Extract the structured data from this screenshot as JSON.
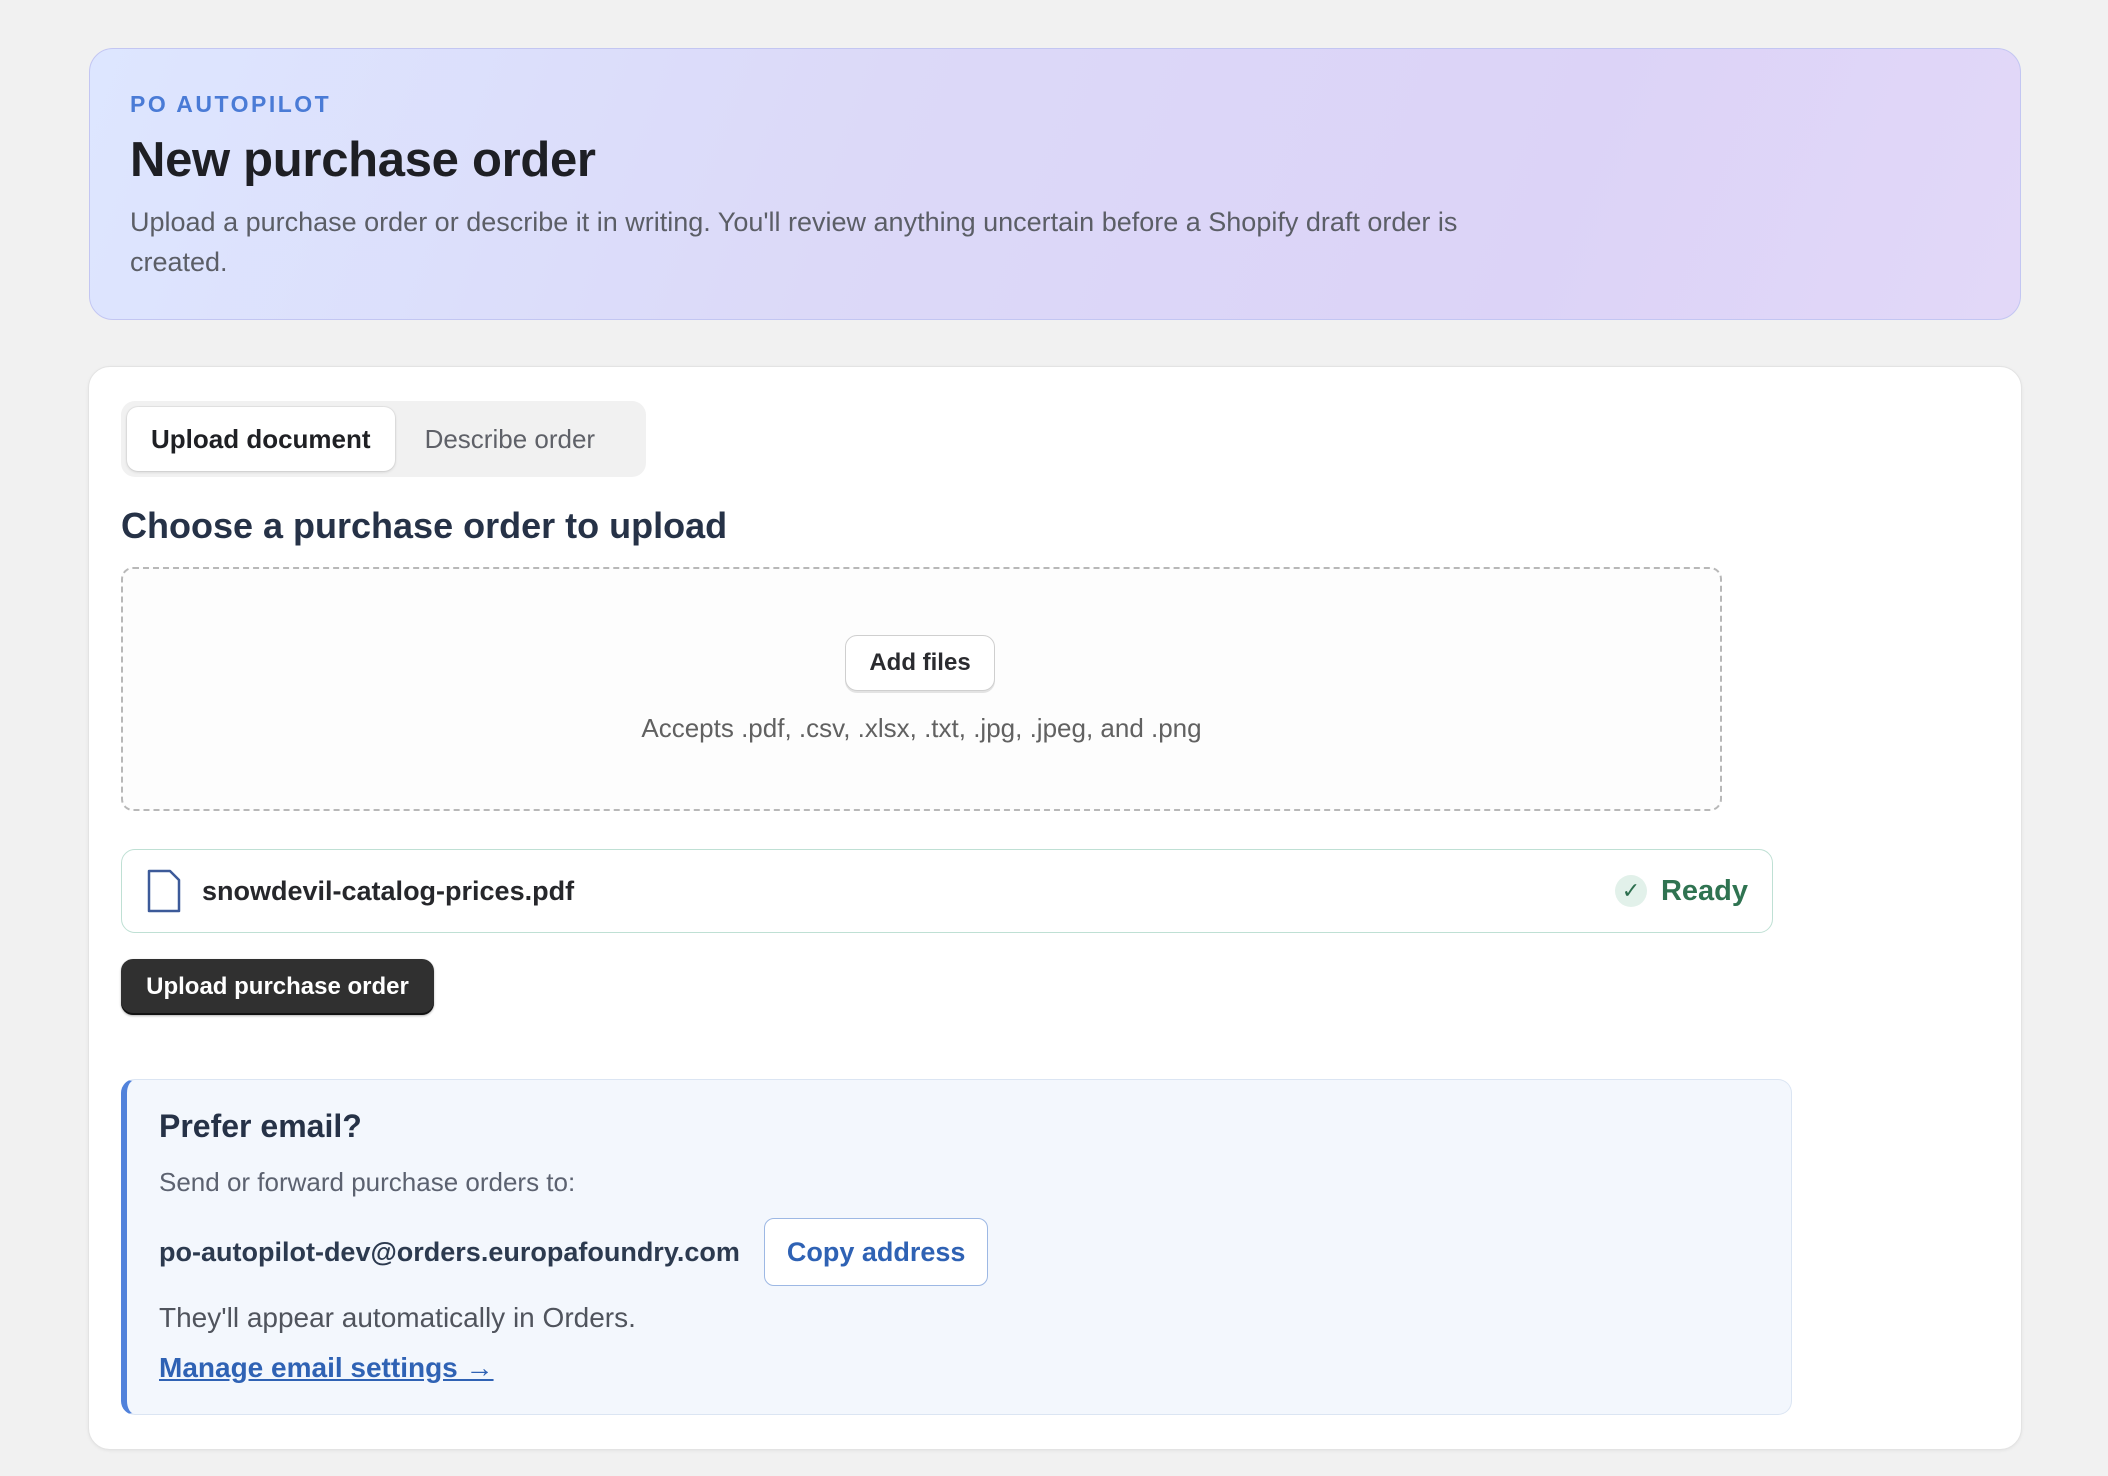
{
  "hero": {
    "eyebrow": "PO AUTOPILOT",
    "title": "New purchase order",
    "subtitle": "Upload a purchase order or describe it in writing. You'll review anything uncertain before a Shopify draft order is created."
  },
  "tabs": [
    {
      "label": "Upload document",
      "active": true
    },
    {
      "label": "Describe order",
      "active": false
    }
  ],
  "upload": {
    "section_title": "Choose a purchase order to upload",
    "add_files_label": "Add files",
    "accepts_text": "Accepts .pdf, .csv, .xlsx, .txt, .jpg, .jpeg, and .png",
    "file": {
      "name": "snowdevil-catalog-prices.pdf",
      "icon": "file-icon",
      "status": "Ready",
      "status_icon": "check-icon",
      "status_glyph": "✓"
    },
    "submit_label": "Upload purchase order"
  },
  "email": {
    "title": "Prefer email?",
    "subtitle": "Send or forward purchase orders to:",
    "address": "po-autopilot-dev@orders.europafoundry.com",
    "copy_label": "Copy address",
    "note": "They'll appear automatically in Orders.",
    "manage_link": "Manage email settings →"
  },
  "colors": {
    "accent": "#4a7bd6",
    "primary_button": "#303030",
    "success": "#2f7351",
    "link": "#2f62b4",
    "panel_border": "#5182db"
  }
}
